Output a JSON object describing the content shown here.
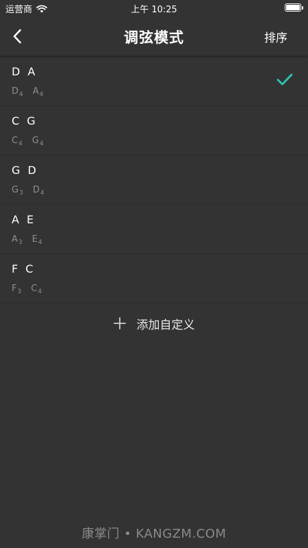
{
  "status_bar": {
    "carrier": "运营商",
    "time": "上午 10:25"
  },
  "nav": {
    "title": "调弦模式",
    "sort_label": "排序"
  },
  "tunings": [
    {
      "name": "D A",
      "notes": [
        {
          "letter": "D",
          "octave": "4"
        },
        {
          "letter": "A",
          "octave": "4"
        }
      ],
      "selected": true
    },
    {
      "name": "C G",
      "notes": [
        {
          "letter": "C",
          "octave": "4"
        },
        {
          "letter": "G",
          "octave": "4"
        }
      ],
      "selected": false
    },
    {
      "name": "G D",
      "notes": [
        {
          "letter": "G",
          "octave": "3"
        },
        {
          "letter": "D",
          "octave": "4"
        }
      ],
      "selected": false
    },
    {
      "name": "A E",
      "notes": [
        {
          "letter": "A",
          "octave": "3"
        },
        {
          "letter": "E",
          "octave": "4"
        }
      ],
      "selected": false
    },
    {
      "name": "F C",
      "notes": [
        {
          "letter": "F",
          "octave": "3"
        },
        {
          "letter": "C",
          "octave": "4"
        }
      ],
      "selected": false
    }
  ],
  "add_custom_label": "添加自定义",
  "watermark": "康掌门 • KANGZM.COM",
  "colors": {
    "background": "#333333",
    "accent_check": "#2ec4b6",
    "secondary_text": "#8e8e8e"
  },
  "icons": {
    "back": "chevron-left-icon",
    "check": "check-icon",
    "add": "plus-icon",
    "wifi": "wifi-icon",
    "battery": "battery-icon"
  }
}
